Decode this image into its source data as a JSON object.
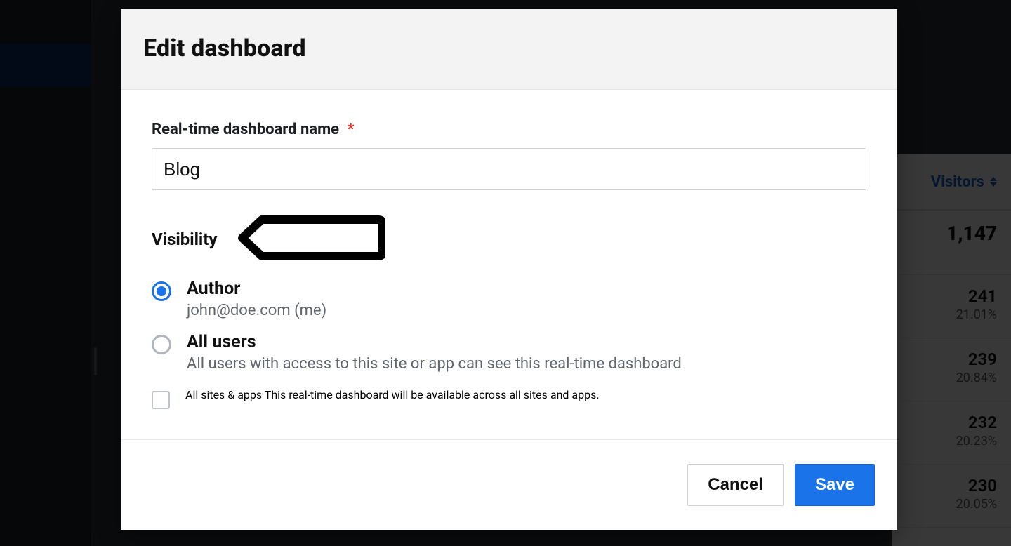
{
  "modal": {
    "title": "Edit dashboard",
    "nameField": {
      "label": "Real-time dashboard name",
      "required": "*",
      "value": "Blog"
    },
    "visibility": {
      "label": "Visibility",
      "options": [
        {
          "title": "Author",
          "sub": "john@doe.com (me)"
        },
        {
          "title": "All users",
          "sub": "All users with access to this site or app can see this real-time dashboard"
        }
      ],
      "allSites": {
        "title": "All sites & apps",
        "sub": "This real-time dashboard will be available across all sites and apps."
      }
    },
    "actions": {
      "cancel": "Cancel",
      "save": "Save"
    }
  },
  "background": {
    "tableHeader": "Visitors",
    "rows": [
      {
        "value": "1,147",
        "pct": ""
      },
      {
        "value": "241",
        "pct": "21.01%"
      },
      {
        "value": "239",
        "pct": "20.84%"
      },
      {
        "value": "232",
        "pct": "20.23%"
      },
      {
        "value": "230",
        "pct": "20.05%"
      }
    ]
  }
}
